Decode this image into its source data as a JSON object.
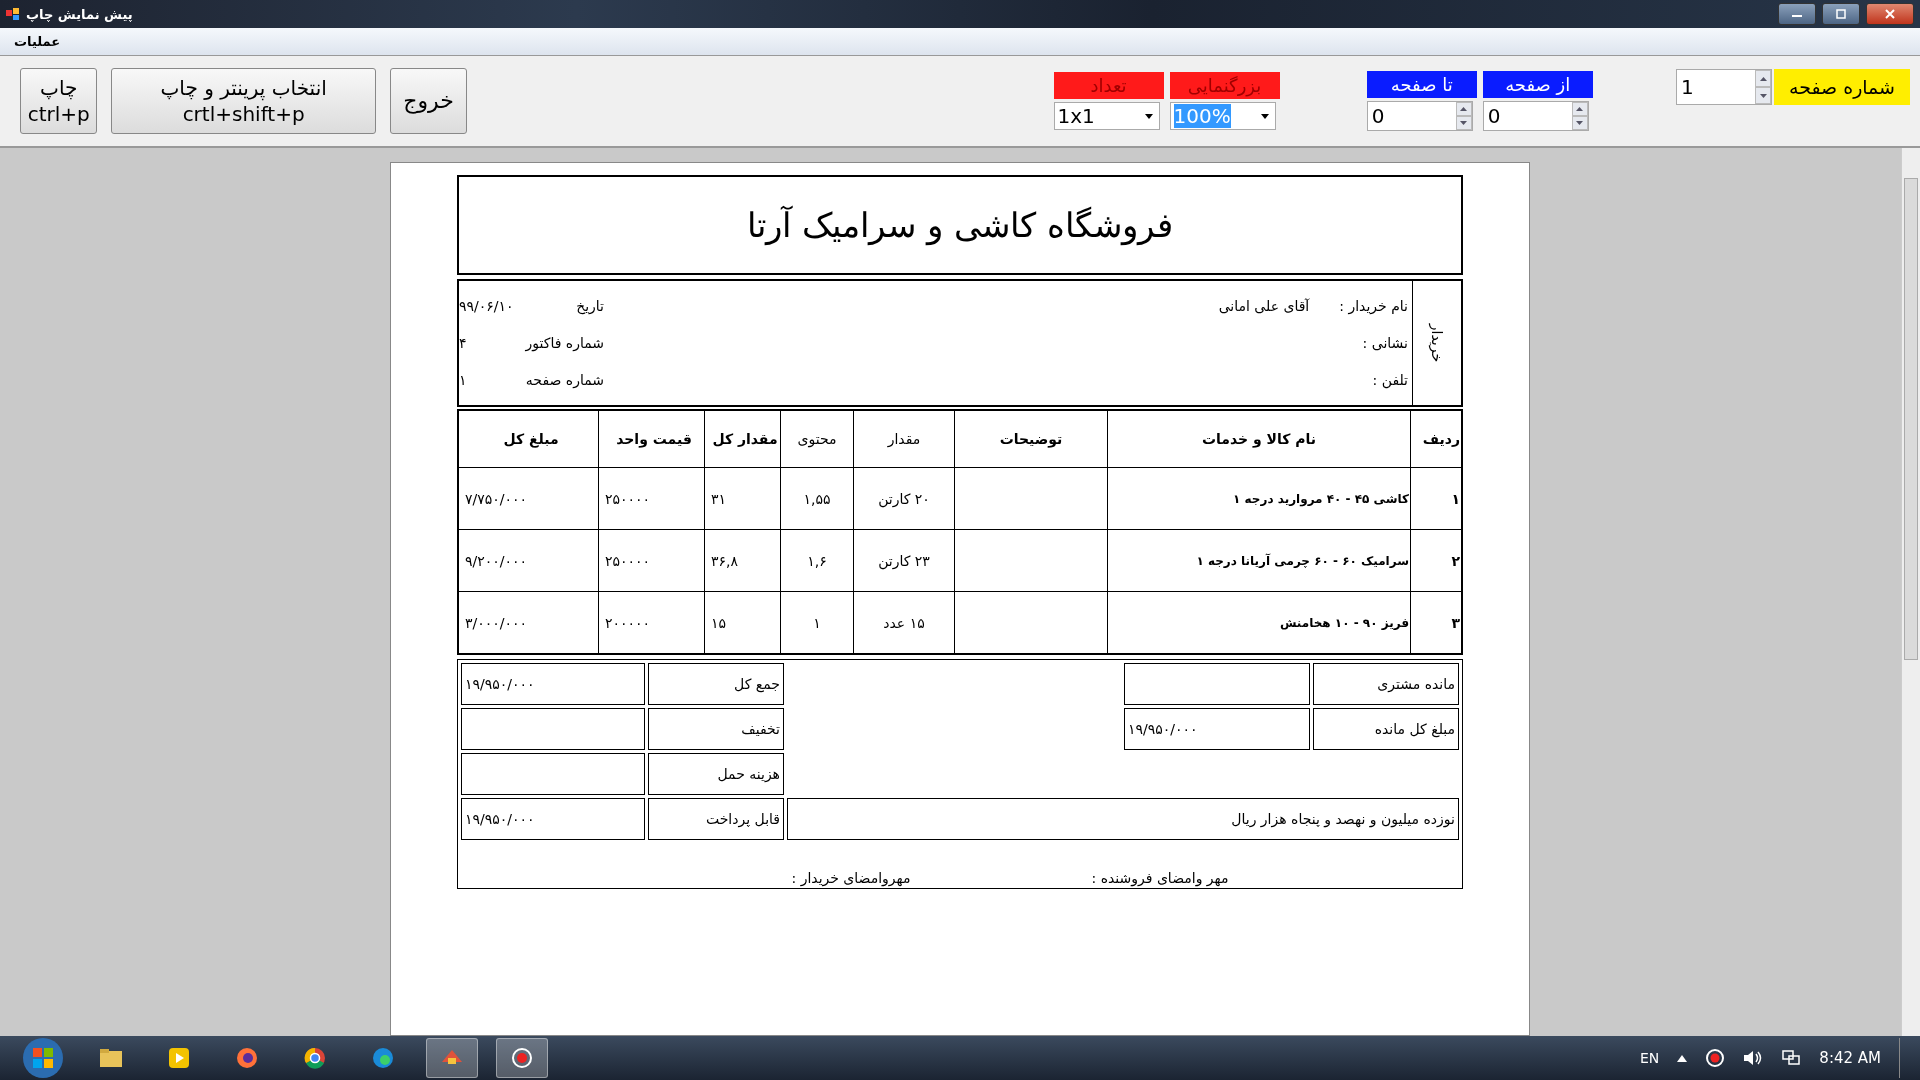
{
  "window": {
    "title": "پیش نمایش چاپ"
  },
  "menu": [
    {
      "label": "عملیات"
    }
  ],
  "toolbar": {
    "page_number": {
      "label": "شماره صفحه",
      "value": "1"
    },
    "from_page": {
      "label": "از صفحه",
      "value": "0"
    },
    "to_page": {
      "label": "تا صفحه",
      "value": "0"
    },
    "zoom": {
      "label": "بزرگنمایی",
      "value": "100%",
      "highlighted": true
    },
    "count": {
      "label": "تعداد",
      "value": "1x1",
      "highlighted": false
    },
    "buttons": [
      {
        "label": "خروج"
      },
      {
        "label": "انتخاب پرینتر و چاپ",
        "shortcut": "crtl+shift+p"
      },
      {
        "label": "چاپ",
        "shortcut": "ctrl+p"
      }
    ]
  },
  "invoice": {
    "store_title": "فروشگاه کاشی و سرامیک آرتا",
    "buyer_section": "خریدار",
    "buyer_fields": [
      {
        "label": "نام خریدار :",
        "value": "آقای علی امانی"
      },
      {
        "label": "نشانی :"
      },
      {
        "label": "تلفن :"
      }
    ],
    "meta": [
      {
        "label": "تاریخ",
        "value": "۹۹/۰۶/۱۰"
      },
      {
        "label": "شماره فاکتور",
        "value": "۴"
      },
      {
        "label": "شماره صفحه",
        "value": "۱"
      }
    ],
    "columns": [
      "ردیف",
      "نام کالا و خدمات",
      "توضیحات",
      "مقدار",
      "محتوی",
      "مقدار کل",
      "قیمت واحد",
      "مبلغ کل"
    ],
    "rows": [
      [
        "۱",
        "کاشی ۴۵ - ۴۰ مروارید درجه ۱",
        "",
        "۲۰ کارتن",
        "۱,۵۵",
        "۳۱",
        "۲۵۰۰۰۰",
        "۷/۷۵۰/۰۰۰"
      ],
      [
        "۲",
        "سرامیک ۶۰ - ۶۰ چرمی آریانا درجه ۱",
        "",
        "۲۳ کارتن",
        "۱,۶",
        "۳۶,۸",
        "۲۵۰۰۰۰",
        "۹/۲۰۰/۰۰۰"
      ],
      [
        "۳",
        "فریز ۹۰ - ۱۰ هخامنش",
        "",
        "۱۵ عدد",
        "۱",
        "۱۵",
        "۲۰۰۰۰۰",
        "۳/۰۰۰/۰۰۰"
      ]
    ],
    "balance": [
      {
        "label": "مانده مشتری"
      },
      {
        "label": "مبلغ کل مانده",
        "value": "۱۹/۹۵۰/۰۰۰"
      }
    ],
    "totals": [
      {
        "label": "جمع کل",
        "value": "۱۹/۹۵۰/۰۰۰"
      },
      {
        "label": "تخفیف"
      },
      {
        "label": "هزینه حمل"
      },
      {
        "label": "قابل پرداخت",
        "value": "۱۹/۹۵۰/۰۰۰"
      }
    ],
    "amount_in_words": "نوزده میلیون و نهصد و پنجاه هزار ریال",
    "signatures": [
      "مهر وامضای فروشنده :",
      "مهروامضای خریدار :"
    ]
  },
  "taskbar": {
    "language": "EN",
    "time": "8:42 AM"
  }
}
